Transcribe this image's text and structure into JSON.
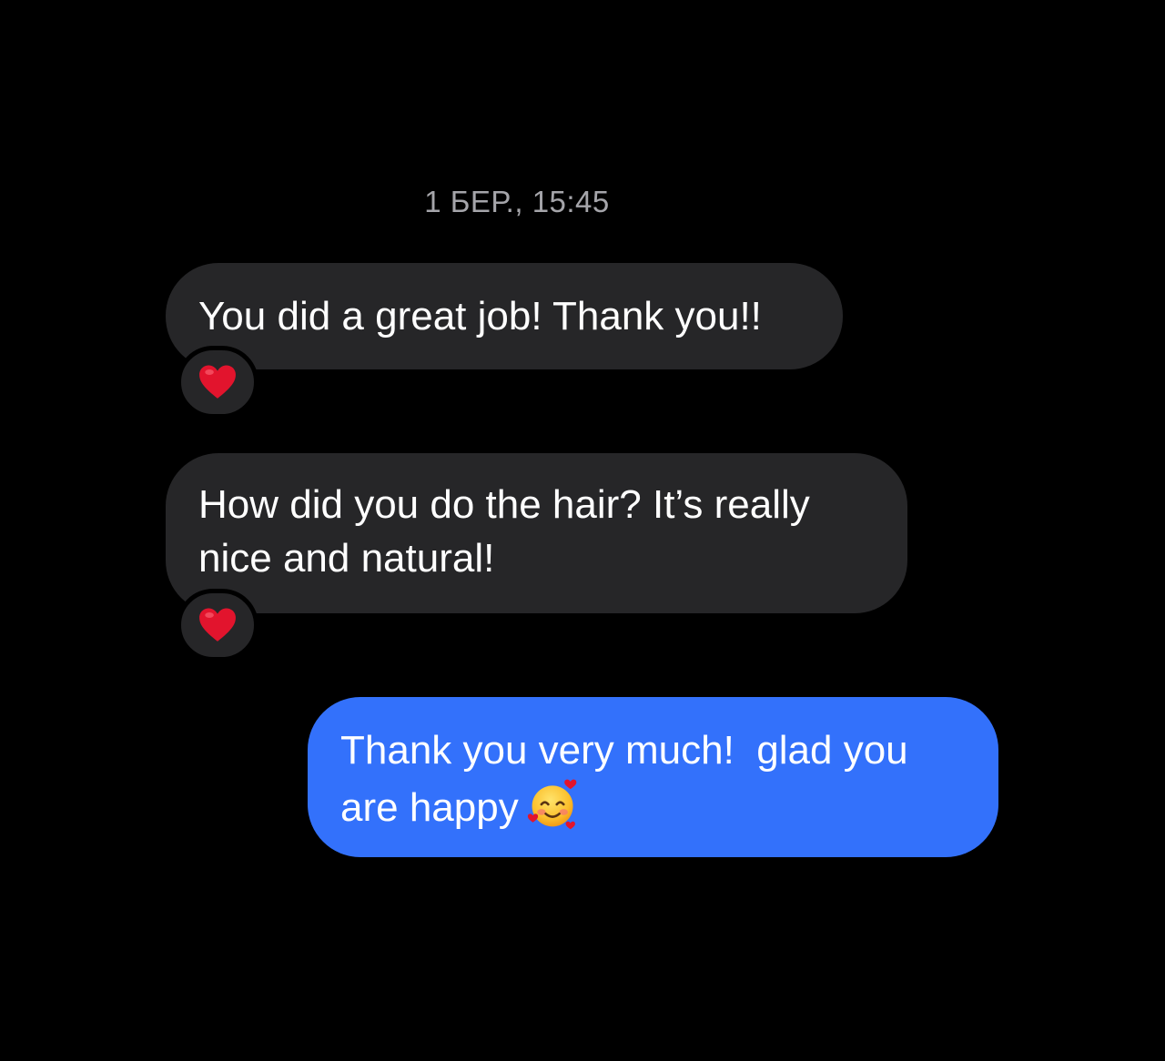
{
  "conversation": {
    "timestamp": "1 БЕР., 15:45",
    "messages": [
      {
        "direction": "incoming",
        "text": "You did a great job! Thank you!!",
        "reaction": "heart-icon"
      },
      {
        "direction": "incoming",
        "text": "How did you do the hair? It’s really\nnice and natural!",
        "reaction": "heart-icon"
      },
      {
        "direction": "outgoing",
        "text": "Thank you very much!  glad you\nare happy",
        "emoji": "smiling-face-with-hearts-icon"
      }
    ]
  },
  "colors": {
    "background": "#000000",
    "incoming_bubble": "#262628",
    "outgoing_bubble": "#3371fb",
    "timestamp_text": "#a5a5aa",
    "message_text": "#ffffff",
    "heart": "#e2142d"
  }
}
